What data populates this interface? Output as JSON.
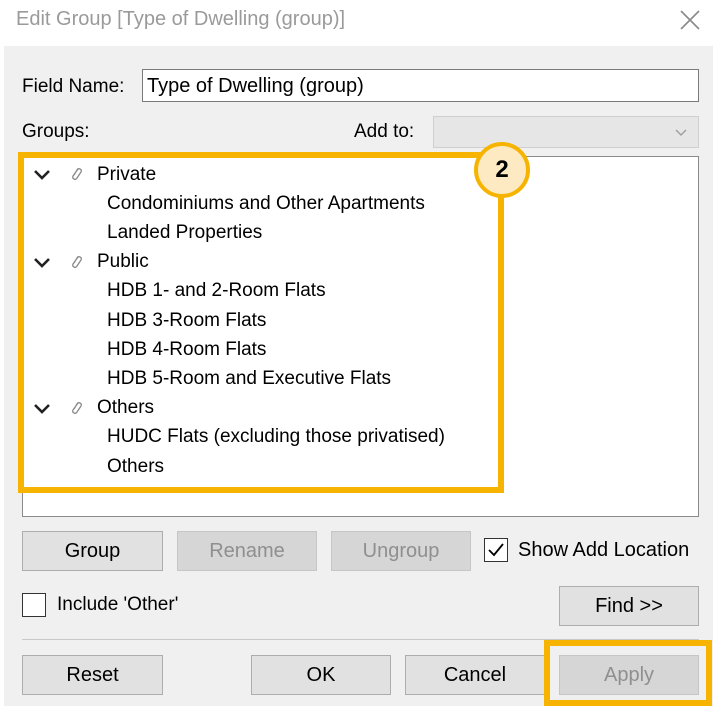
{
  "dialog": {
    "title": "Edit Group [Type of Dwelling (group)]",
    "close_icon": "close-icon"
  },
  "field_name": {
    "label": "Field Name:",
    "value": "Type of Dwelling (group)"
  },
  "groups": {
    "label": "Groups:",
    "add_to_label": "Add to:",
    "add_to_value": "",
    "tree": [
      {
        "label": "Private",
        "expanded": true,
        "children": [
          "Condominiums and Other Apartments",
          "Landed Properties"
        ]
      },
      {
        "label": "Public",
        "expanded": true,
        "children": [
          "HDB 1- and 2-Room Flats",
          "HDB 3-Room Flats",
          "HDB 4-Room Flats",
          "HDB 5-Room and Executive Flats"
        ]
      },
      {
        "label": "Others",
        "expanded": true,
        "children": [
          "HUDC Flats (excluding those privatised)",
          "Others"
        ]
      }
    ]
  },
  "annotation": {
    "badge": "2",
    "color": "#f6b400"
  },
  "buttons": {
    "group": "Group",
    "rename": "Rename",
    "ungroup": "Ungroup",
    "find": "Find >>",
    "reset": "Reset",
    "ok": "OK",
    "cancel": "Cancel",
    "apply": "Apply"
  },
  "options": {
    "show_add_location": {
      "label": "Show Add Location",
      "checked": true
    },
    "include_other": {
      "label": "Include 'Other'",
      "checked": false
    }
  }
}
